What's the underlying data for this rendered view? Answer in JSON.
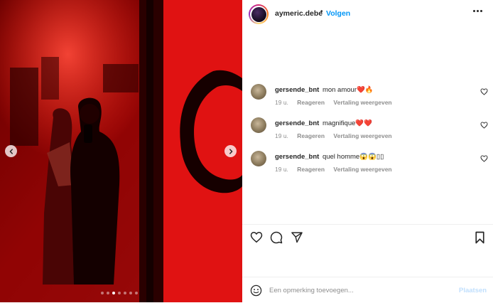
{
  "post": {
    "username": "aymeric.debe",
    "separator": "•",
    "follow_label": "Volgen",
    "photo": {
      "carousel_count": 7,
      "active_index": 2
    }
  },
  "comments": [
    {
      "user": "gersende_bnt",
      "text": "mon amour❤️🔥",
      "time": "19 u.",
      "reply": "Reageren",
      "translate": "Vertaling weergeven"
    },
    {
      "user": "gersende_bnt",
      "text": "magnifique❤️❤️",
      "time": "19 u.",
      "reply": "Reageren",
      "translate": "Vertaling weergeven"
    },
    {
      "user": "gersende_bnt",
      "text": "quel homme😱😱▯▯",
      "time": "19 u.",
      "reply": "Reageren",
      "translate": "Vertaling weergeven"
    }
  ],
  "compose": {
    "placeholder": "Een opmerking toevoegen...",
    "post_label": "Plaatsen"
  },
  "icons": {
    "like": "heart-icon",
    "comment": "comment-icon",
    "share": "paper-plane-icon",
    "save": "bookmark-icon",
    "emoji": "smiley-icon",
    "more": "more-dots-icon",
    "prev": "chevron-left-icon",
    "next": "chevron-right-icon"
  },
  "colors": {
    "link": "#0095f6",
    "post_disabled": "#c0dffd",
    "photo_tint": "#b00000"
  }
}
